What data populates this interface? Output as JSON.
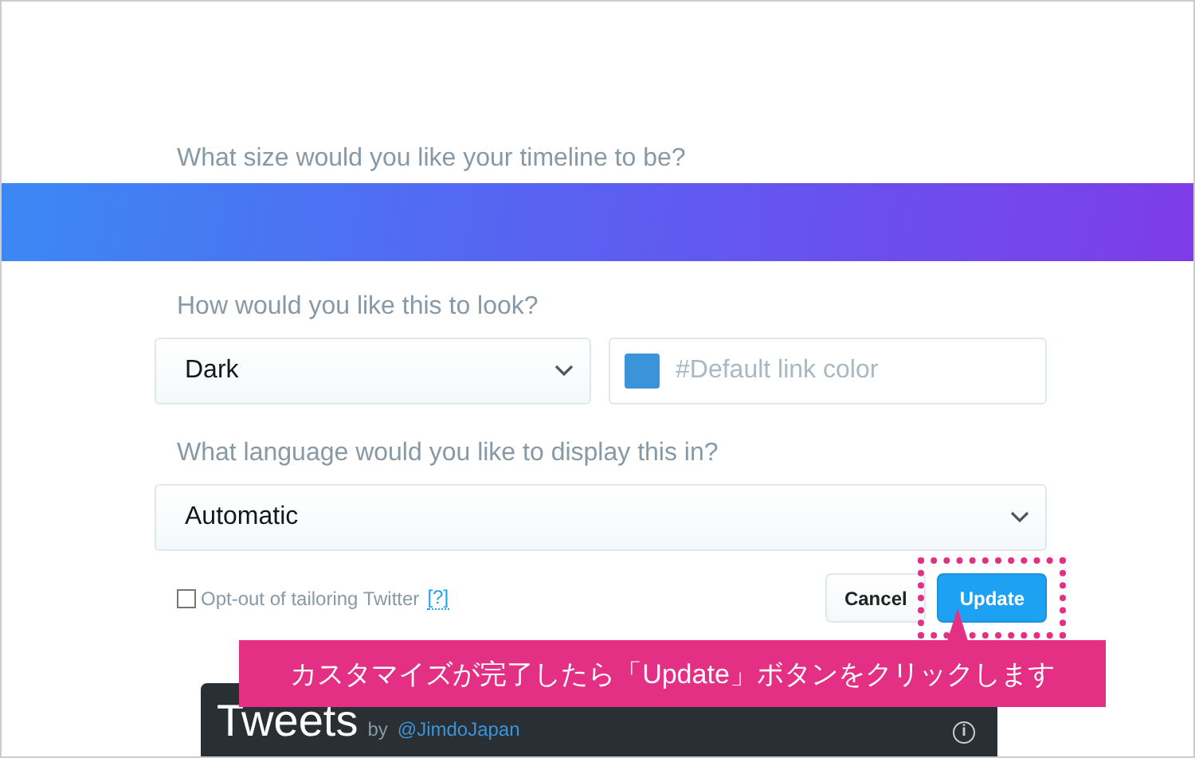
{
  "sections": [
    {
      "question": "What size would you like your timeline to be?"
    },
    {
      "question": "How would you like this to look?"
    },
    {
      "question": "What language would you like to display this in?"
    }
  ],
  "theme_select": {
    "value": "Dark"
  },
  "link_color": {
    "placeholder": "#Default link color",
    "color": "#3b94d9"
  },
  "language_select": {
    "value": "Automatic"
  },
  "opt_out": {
    "label": "Opt-out of tailoring Twitter",
    "help": "[?]",
    "checked": false
  },
  "buttons": [
    {
      "label": "Cancel",
      "kind": "secondary"
    },
    {
      "label": "Update",
      "kind": "primary",
      "highlighted": true
    }
  ],
  "callout": "カスタマイズが完了したら「Update」ボタンをクリックします",
  "widget": {
    "title": "Tweets",
    "by": "by",
    "handle": "@JimdoJapan",
    "info": "i"
  }
}
